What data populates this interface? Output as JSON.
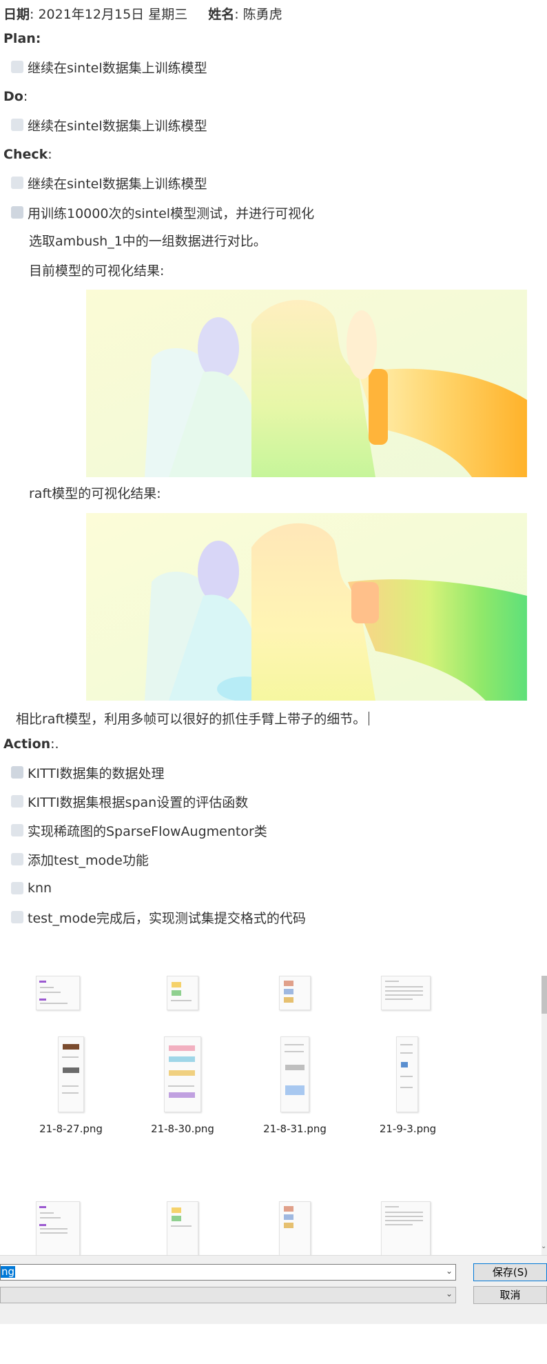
{
  "header": {
    "date_label": "日期",
    "date_value": ": 2021年12月15日 星期三",
    "name_label": "姓名",
    "name_value": ": 陈勇虎"
  },
  "plan": {
    "heading": "Plan",
    "heading_suffix": ":",
    "items": [
      "继续在sintel数据集上训练模型"
    ]
  },
  "do": {
    "heading": "Do",
    "heading_suffix": ":",
    "items": [
      "继续在sintel数据集上训练模型"
    ]
  },
  "check": {
    "heading": "Check",
    "heading_suffix": ":",
    "items": [
      "继续在sintel数据集上训练模型",
      "用训练10000次的sintel模型测试，并进行可视化"
    ],
    "note1": "选取ambush_1中的一组数据进行对比。",
    "current_label": "目前模型的可视化结果:",
    "raft_label": "raft模型的可视化结果:",
    "conclusion": "相比raft模型，利用多帧可以很好的抓住手臂上带子的细节。"
  },
  "action": {
    "heading": "Action",
    "heading_suffix": ":.",
    "items": [
      "KITTI数据集的数据处理",
      "KITTI数据集根据span设置的评估函数",
      "实现稀疏图的SparseFlowAugmentor类",
      "添加test_mode功能",
      "knn",
      "test_mode完成后，实现测试集提交格式的代码"
    ]
  },
  "file_dialog": {
    "file_names": [
      "21-8-27.png",
      "21-8-30.png",
      "21-8-31.png",
      "21-9-3.png"
    ],
    "filename_selected_text": "ng",
    "save_button": "保存(S)",
    "cancel_button": "取消",
    "dropdown_icon": "chevron-down-icon",
    "colors": {
      "selection": "#0078d7",
      "tag": "#9b59d0"
    }
  }
}
